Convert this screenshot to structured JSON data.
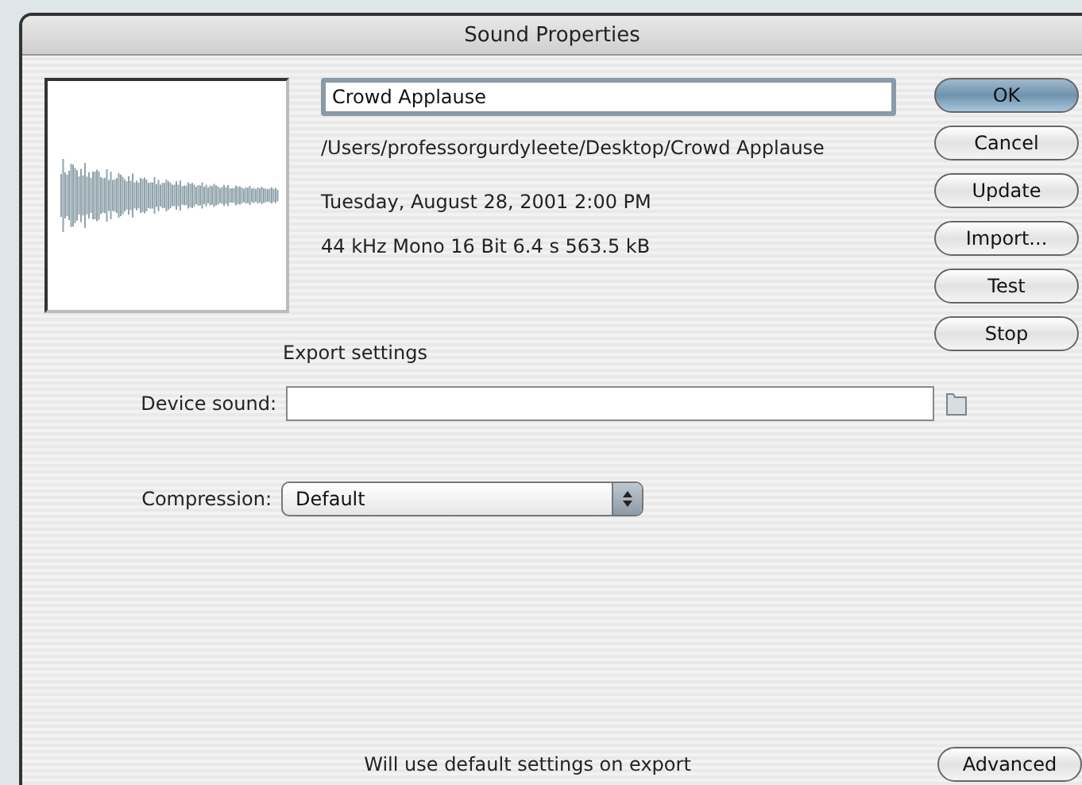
{
  "window": {
    "title": "Sound Properties"
  },
  "sound": {
    "name": "Crowd Applause",
    "path": "/Users/professorgurdyleete/Desktop/Crowd Applause",
    "date": "Tuesday, August 28, 2001  2:00 PM",
    "format": "44 kHz Mono 16 Bit 6.4 s 563.5 kB"
  },
  "buttons": [
    {
      "label": "OK",
      "default": true
    },
    {
      "label": "Cancel",
      "default": false
    },
    {
      "label": "Update",
      "default": false
    },
    {
      "label": "Import...",
      "default": false
    },
    {
      "label": "Test",
      "default": false
    },
    {
      "label": "Stop",
      "default": false
    }
  ],
  "export": {
    "heading": "Export settings",
    "device_label": "Device sound:",
    "compression_label": "Compression:",
    "compression_value": "Default"
  },
  "status": "Will use default settings on export",
  "advanced_button": "Advanced"
}
